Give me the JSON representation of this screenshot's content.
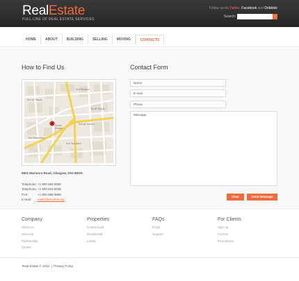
{
  "header": {
    "logo_part1": "Real",
    "logo_part2": "Estate",
    "tagline": "FULL LINE OF REAL ESTATE SERVICES",
    "follow_prefix": "Follow us on",
    "follow_twitter": "Twitter",
    "follow_sep1": ",",
    "follow_facebook": "Facebook",
    "follow_and": "and",
    "follow_dribbble": "Dribbble",
    "search_label": "Search:",
    "search_value": "",
    "search_button": "›"
  },
  "nav": {
    "items": [
      "HOME",
      "ABOUT",
      "BUILDING",
      "SELLING",
      "MOVING",
      "CONTACTS"
    ],
    "active": "CONTACTS"
  },
  "find_us": {
    "title": "How to Find Us",
    "address": "8901 Marmora Road, Glasgow, D04 89GR.",
    "telephone_label": "Telephone:",
    "telephone": "+1 800 559 6580",
    "telephone2_label": "Telephone:",
    "telephone2": "+1 800 603 6035",
    "fax_label": "FAX:",
    "fax": "+1 800 889 9898",
    "email_label": "E-mail:",
    "email": "mail@demolink.org"
  },
  "contact_form": {
    "title": "Contact Form",
    "name_placeholder": "Name",
    "email_placeholder": "E-mail",
    "phone_placeholder": "Phone",
    "message_placeholder": "Message",
    "clear_label": "Clear",
    "send_label": "Send Message"
  },
  "footer": {
    "columns": [
      {
        "title": "Company",
        "items": [
          "About us",
          "Services",
          "Partnership",
          "Clients"
        ]
      },
      {
        "title": "Properties",
        "items": [
          "Commercial",
          "Residential",
          "Lands"
        ]
      },
      {
        "title": "FAQs",
        "items": [
          "FAQs",
          "Support"
        ]
      },
      {
        "title": "For Clients",
        "items": [
          "Sign up",
          "Forums",
          "Promotions"
        ]
      }
    ],
    "copyright": "Real Estate © 2012",
    "privacy": "Privacy Policy"
  },
  "colors": {
    "accent": "#f06a3c",
    "header_bg": "#2c2c2c",
    "body_bg": "#f8f8f8"
  }
}
